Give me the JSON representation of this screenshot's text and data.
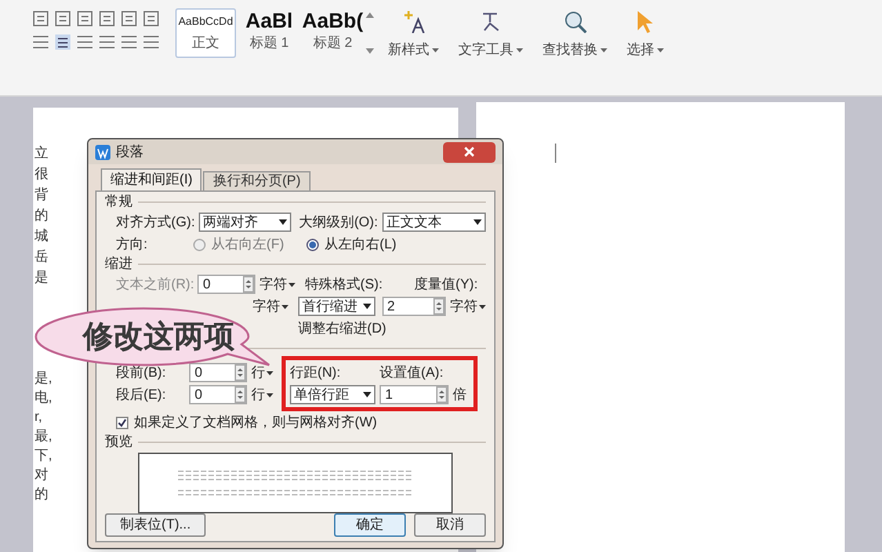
{
  "toolbar": {
    "styles": [
      {
        "preview": "AaBbCcDd",
        "label": "正文",
        "selected": true
      },
      {
        "preview": "AaBl",
        "label": "标题 1",
        "selected": false
      },
      {
        "preview": "AaBb(",
        "label": "标题 2",
        "selected": false
      }
    ],
    "tools": [
      {
        "label": "新样式",
        "kind": "sparkle"
      },
      {
        "label": "文字工具",
        "kind": "text"
      },
      {
        "label": "查找替换",
        "kind": "find"
      },
      {
        "label": "选择",
        "kind": "pointer"
      }
    ]
  },
  "document": {
    "left_page_text": {
      "upper": [
        "立",
        "很",
        "背",
        "的",
        "城",
        "岳",
        "是"
      ],
      "lower": [
        "是,",
        "电,",
        "r,",
        "最,",
        "下,",
        "对",
        "的"
      ]
    }
  },
  "dialog": {
    "title": "段落",
    "tabs": [
      {
        "label": "缩进和间距(I)",
        "selected": true
      },
      {
        "label": "换行和分页(P)",
        "selected": false
      }
    ],
    "general": {
      "heading": "常规",
      "alignment": {
        "label": "对齐方式(G):",
        "value": "两端对齐"
      },
      "outline": {
        "label": "大纲级别(O):",
        "value": "正文文本"
      },
      "direction": {
        "label": "方向:",
        "options": [
          {
            "label": "从右向左(F)",
            "selected": false
          },
          {
            "label": "从左向右(L)",
            "selected": true
          }
        ]
      }
    },
    "indent": {
      "heading": "缩进",
      "before": {
        "label": "文本之前(R):",
        "value": "0",
        "unit": "字符"
      },
      "after": {
        "unit": "字符"
      },
      "special": {
        "label": "特殊格式(S):",
        "value": "首行缩进"
      },
      "measure": {
        "label": "度量值(Y):",
        "value": "2",
        "unit": "字符"
      },
      "auto_adjust": {
        "label": "调整右缩进(D)"
      }
    },
    "spacing": {
      "before": {
        "label": "段前(B):",
        "value": "0",
        "unit": "行"
      },
      "after": {
        "label": "段后(E):",
        "value": "0",
        "unit": "行"
      },
      "line_spacing": {
        "label": "行距(N):",
        "value": "单倍行距"
      },
      "set_value": {
        "label": "设置值(A):",
        "value": "1",
        "unit": "倍"
      },
      "grid_snap": {
        "label": "如果定义了文档网格，则与网格对齐(W)",
        "checked": true
      }
    },
    "preview": {
      "heading": "预览"
    },
    "buttons": [
      {
        "label": "制表位(T)...",
        "kind": "secondary"
      },
      {
        "label": "确定",
        "kind": "primary"
      },
      {
        "label": "取消",
        "kind": "secondary"
      }
    ]
  },
  "callout": {
    "text": "修改这两项"
  }
}
